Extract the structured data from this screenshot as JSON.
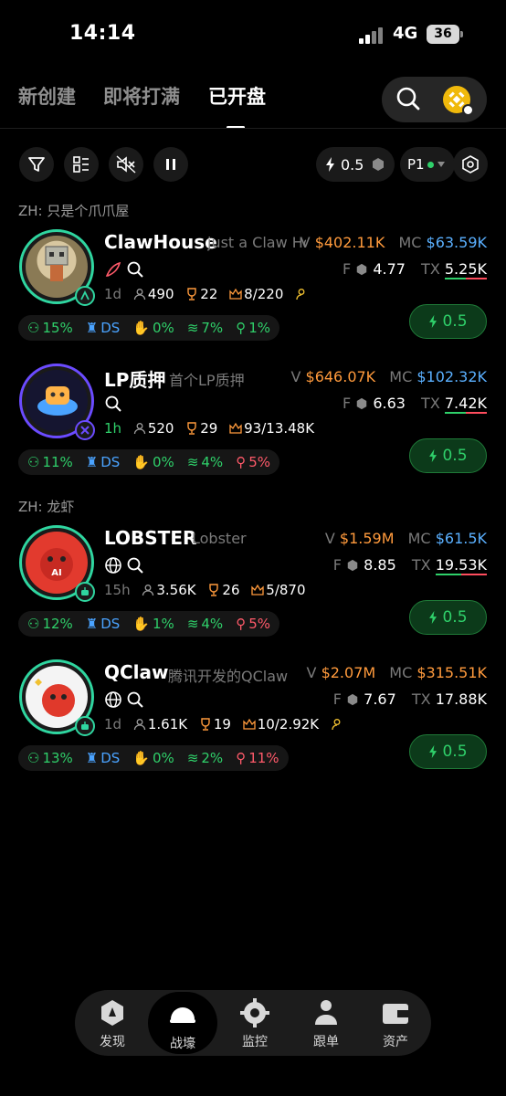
{
  "status": {
    "time": "14:14",
    "network": "4G",
    "battery": "36"
  },
  "tabs": [
    {
      "label": "新创建"
    },
    {
      "label": "即将打满"
    },
    {
      "label": "已开盘"
    }
  ],
  "toolbar": {
    "boost_value": "0.5",
    "preset": "P1"
  },
  "sections": [
    "ZH: 只是个爪爪屋",
    "ZH: 龙虾"
  ],
  "tokens": [
    {
      "name": "ClawHouse",
      "desc": "just a Claw House",
      "v_label": "V",
      "v": "$402.11K",
      "mc_label": "MC",
      "mc": "$63.59K",
      "f_label": "F",
      "f": "4.77",
      "tx_label": "TX",
      "tx": "5.25K",
      "age": "1d",
      "holders": "490",
      "trophy": "22",
      "crown": "8/220",
      "chips": [
        "15%",
        "DS",
        "0%",
        "7%",
        "1%"
      ],
      "buy": "0.5"
    },
    {
      "name": "LP质押",
      "desc": "首个LP质押",
      "v_label": "V",
      "v": "$646.07K",
      "mc_label": "MC",
      "mc": "$102.32K",
      "f_label": "F",
      "f": "6.63",
      "tx_label": "TX",
      "tx": "7.42K",
      "age": "1h",
      "holders": "520",
      "trophy": "29",
      "crown": "93/13.48K",
      "chips": [
        "11%",
        "DS",
        "0%",
        "4%",
        "5%"
      ],
      "buy": "0.5"
    },
    {
      "name": "LOBSTER",
      "desc": "Lobster",
      "v_label": "V",
      "v": "$1.59M",
      "mc_label": "MC",
      "mc": "$61.5K",
      "f_label": "F",
      "f": "8.85",
      "tx_label": "TX",
      "tx": "19.53K",
      "age": "15h",
      "holders": "3.56K",
      "trophy": "26",
      "crown": "5/870",
      "chips": [
        "12%",
        "DS",
        "1%",
        "4%",
        "5%"
      ],
      "buy": "0.5"
    },
    {
      "name": "QClaw",
      "desc": "腾讯开发的QClaw",
      "v_label": "V",
      "v": "$2.07M",
      "mc_label": "MC",
      "mc": "$315.51K",
      "f_label": "F",
      "f": "7.67",
      "tx_label": "TX",
      "tx": "17.88K",
      "age": "1d",
      "holders": "1.61K",
      "trophy": "19",
      "crown": "10/2.92K",
      "chips": [
        "13%",
        "DS",
        "0%",
        "2%",
        "11%"
      ],
      "buy": "0.5"
    }
  ],
  "nav": [
    {
      "label": "发现",
      "icon": "discover-icon"
    },
    {
      "label": "战壕",
      "icon": "helmet-icon"
    },
    {
      "label": "监控",
      "icon": "monitor-icon"
    },
    {
      "label": "跟单",
      "icon": "copy-trade-icon"
    },
    {
      "label": "资产",
      "icon": "wallet-icon"
    }
  ],
  "colors": {
    "accent_green": "#2fd06a",
    "value_orange": "#ff9a3c",
    "value_blue": "#5ab0ff",
    "negative_red": "#ff5a6a"
  }
}
